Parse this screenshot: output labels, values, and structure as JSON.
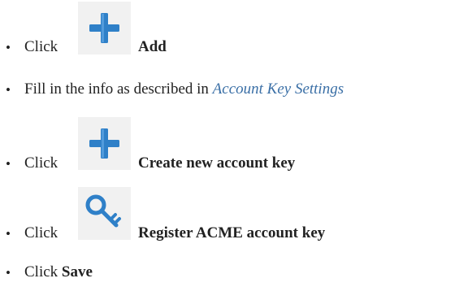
{
  "steps": [
    {
      "bullet": "•",
      "prefix": "Click",
      "icon": "plus-icon",
      "label": "Add"
    },
    {
      "bullet": "•",
      "prefix": "Fill in the info as described in",
      "link": "Account Key Settings"
    },
    {
      "bullet": "•",
      "prefix": "Click",
      "icon": "plus-icon",
      "label": "Create new account key"
    },
    {
      "bullet": "•",
      "prefix": "Click",
      "icon": "key-icon",
      "label": "Register ACME account key"
    },
    {
      "bullet": "•",
      "prefix": "Click",
      "label": "Save"
    }
  ],
  "colors": {
    "plus_icon": "#2f80c8",
    "key_icon": "#2f80c8",
    "link": "#3a6fa6",
    "icon_background": "#f1f1f1"
  }
}
